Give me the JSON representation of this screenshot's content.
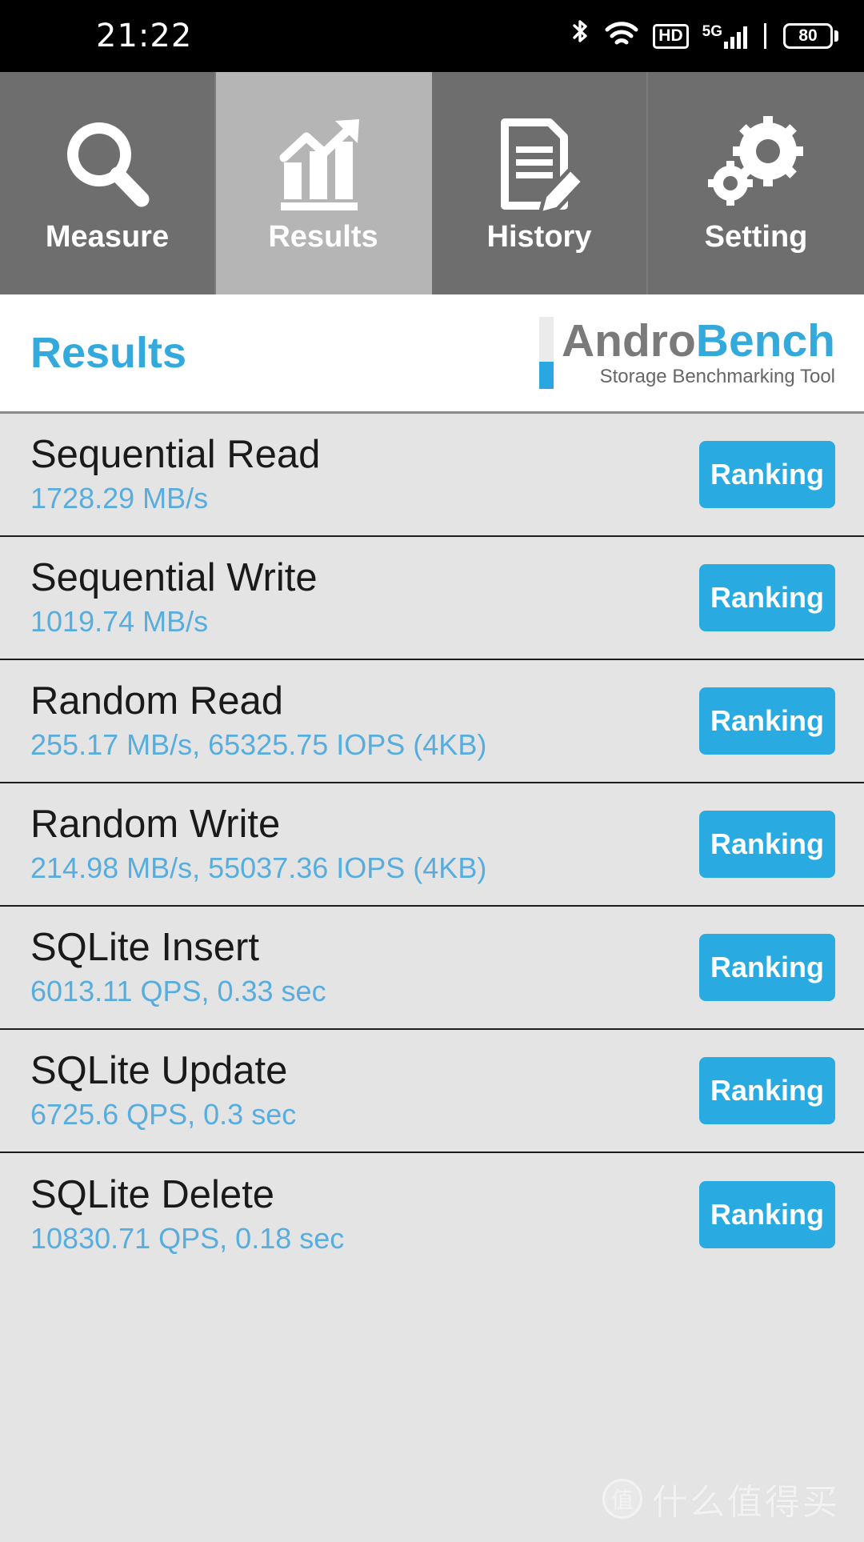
{
  "status_bar": {
    "time": "21:22",
    "icons": [
      "bluetooth-icon",
      "wifi-icon",
      "hd-icon",
      "5g-icon",
      "signal-icon",
      "battery-icon"
    ],
    "hd_label": "HD",
    "network_label": "5G",
    "battery_level": "80"
  },
  "tabs": [
    {
      "label": "Measure",
      "icon": "magnifier-icon",
      "active": false
    },
    {
      "label": "Results",
      "icon": "bar-chart-arrow-icon",
      "active": true
    },
    {
      "label": "History",
      "icon": "document-pencil-icon",
      "active": false
    },
    {
      "label": "Setting",
      "icon": "gears-icon",
      "active": false
    }
  ],
  "header": {
    "page_title": "Results",
    "brand_first": "Andro",
    "brand_second": "Bench",
    "brand_subtitle": "Storage Benchmarking Tool"
  },
  "colors": {
    "accent_blue": "#29abe2",
    "value_blue": "#57aede",
    "title_blue": "#33a9dc",
    "brand_gray": "#7a7a7a",
    "tab_bg": "#6e6e6e",
    "tab_active_bg": "#b5b5b5",
    "list_bg": "#e4e4e4"
  },
  "ranking_button_label": "Ranking",
  "results": [
    {
      "name": "Sequential Read",
      "value": "1728.29 MB/s"
    },
    {
      "name": "Sequential Write",
      "value": "1019.74 MB/s"
    },
    {
      "name": "Random Read",
      "value": "255.17 MB/s, 65325.75 IOPS (4KB)"
    },
    {
      "name": "Random Write",
      "value": "214.98 MB/s, 55037.36 IOPS (4KB)"
    },
    {
      "name": "SQLite Insert",
      "value": "6013.11 QPS, 0.33 sec"
    },
    {
      "name": "SQLite Update",
      "value": "6725.6 QPS, 0.3 sec"
    },
    {
      "name": "SQLite Delete",
      "value": "10830.71 QPS, 0.18 sec"
    }
  ],
  "watermark": {
    "logo_char": "值",
    "text": "什么值得买"
  }
}
